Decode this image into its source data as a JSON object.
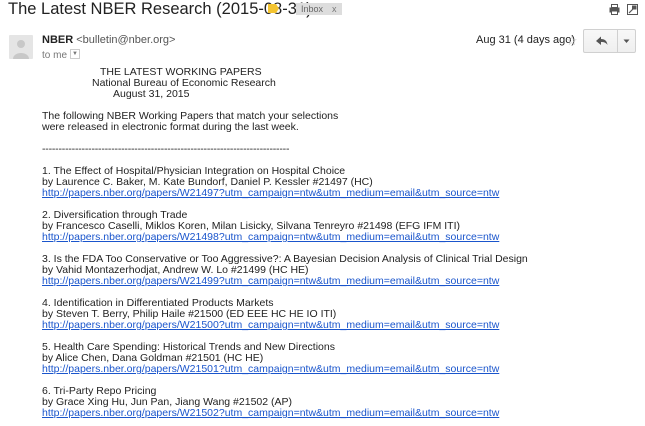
{
  "subject": "The Latest NBER Research (2015-08-31)",
  "label_tag": {
    "text": "Inbox",
    "close": "x"
  },
  "icons": {
    "label": "label-icon",
    "print": "print-icon",
    "new_window": "new-window-icon",
    "star": "star-icon",
    "reply": "reply-icon",
    "more": "chevron-down-icon",
    "avatar": "avatar-icon"
  },
  "sender": {
    "name": "NBER",
    "email": "<bulletin@nber.org>",
    "to": "to me"
  },
  "date": "Aug 31 (4 days ago)",
  "body": {
    "header_lines": [
      "THE LATEST WORKING PAPERS",
      "National Bureau of Economic Research",
      "August 31, 2015"
    ],
    "intro_lines": [
      "The following NBER Working Papers that match your selections",
      "were released in electronic format during the last week."
    ],
    "divider": "---------------------------------------------------------------------------",
    "papers": [
      {
        "title": "1.  The Effect of Hospital/Physician Integration on Hospital Choice",
        "authors": "by Laurence C. Baker, M. Kate Bundorf, Daniel P. Kessler #21497 (HC)",
        "link": "http://papers.nber.org/papers/W21497?utm_campaign=ntw&utm_medium=email&utm_source=ntw"
      },
      {
        "title": "2.  Diversification through Trade",
        "authors": "by Francesco Caselli, Miklos Koren, Milan Lisicky, Silvana Tenreyro #21498 (EFG IFM ITI)",
        "link": "http://papers.nber.org/papers/W21498?utm_campaign=ntw&utm_medium=email&utm_source=ntw"
      },
      {
        "title": "3.  Is the FDA Too Conservative or Too Aggressive?: A Bayesian Decision Analysis of Clinical Trial Design",
        "authors": "by Vahid Montazerhodjat, Andrew W. Lo #21499 (HC HE)",
        "link": "http://papers.nber.org/papers/W21499?utm_campaign=ntw&utm_medium=email&utm_source=ntw"
      },
      {
        "title": "4.  Identification in Differentiated Products Markets",
        "authors": "by Steven T. Berry, Philip Haile #21500 (ED EEE HC HE IO ITI)",
        "link": "http://papers.nber.org/papers/W21500?utm_campaign=ntw&utm_medium=email&utm_source=ntw"
      },
      {
        "title": "5.  Health Care Spending: Historical Trends and New Directions",
        "authors": "by Alice Chen, Dana Goldman #21501 (HC HE)",
        "link": "http://papers.nber.org/papers/W21501?utm_campaign=ntw&utm_medium=email&utm_source=ntw"
      },
      {
        "title": "6.  Tri-Party Repo Pricing",
        "authors": "by Grace Xing Hu, Jun Pan, Jiang Wang #21502 (AP)",
        "link": "http://papers.nber.org/papers/W21502?utm_campaign=ntw&utm_medium=email&utm_source=ntw"
      }
    ]
  },
  "colors": {
    "link": "#1a55cc",
    "label": "#f4c430",
    "tag_bg": "#dddddd"
  }
}
